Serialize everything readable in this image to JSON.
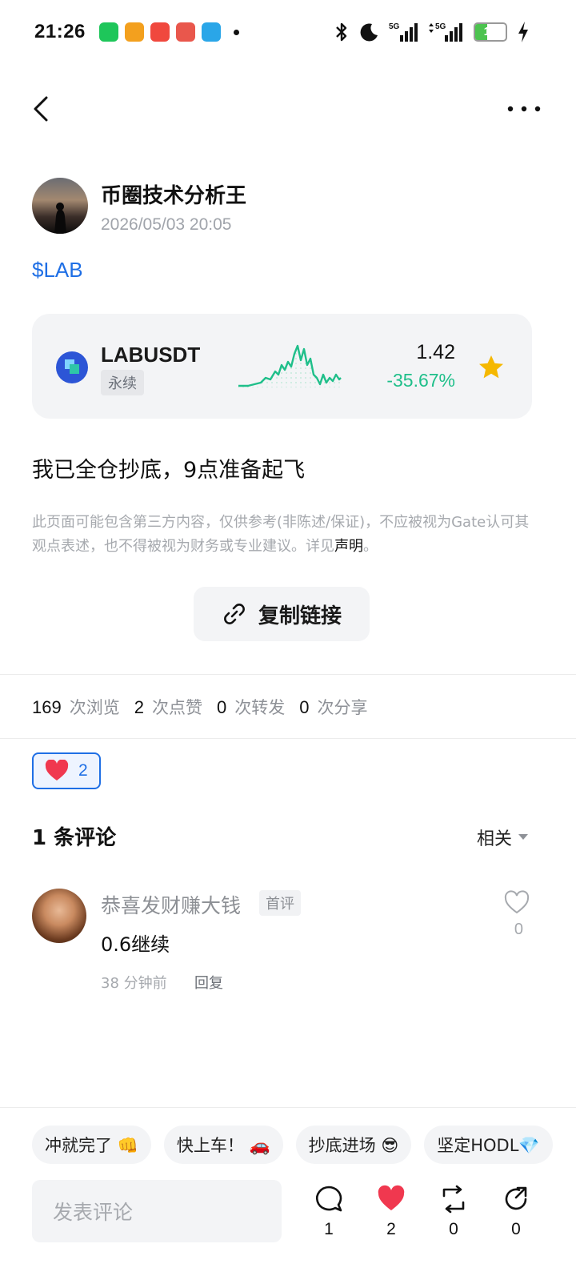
{
  "status_bar": {
    "time": "21:26",
    "battery": "15",
    "network_1": "5G",
    "network_2": "5G"
  },
  "post": {
    "author_name": "币圈技术分析王",
    "timestamp": "2026/05/03 20:05",
    "ticker_tag": "$LAB",
    "body": "我已全仓抄底，9点准备起飞",
    "disclaimer_text": "此页面可能包含第三方内容，仅供参考(非陈述/保证)，不应被视为Gate认可其观点表述，也不得被视为财务或专业建议。详见",
    "disclaimer_link": "声明",
    "disclaimer_end": "。",
    "copy_link_label": "复制链接"
  },
  "market_card": {
    "pair": "LABUSDT",
    "type": "永续",
    "price": "1.42",
    "change": "-35.67%",
    "favorited": true,
    "colors": {
      "up": "#1fbf8a",
      "star": "#f5b800"
    }
  },
  "stats": [
    {
      "count": "169",
      "label": "次浏览"
    },
    {
      "count": "2",
      "label": "次点赞"
    },
    {
      "count": "0",
      "label": "次转发"
    },
    {
      "count": "0",
      "label": "次分享"
    }
  ],
  "reaction": {
    "icon": "heart-icon",
    "count": "2"
  },
  "comments": {
    "header": "1 条评论",
    "sort_label": "相关",
    "items": [
      {
        "author": "恭喜发财赚大钱",
        "badge": "首评",
        "text": "0.6继续",
        "time": "38 分钟前",
        "reply_label": "回复",
        "likes": "0"
      }
    ]
  },
  "quick_replies": [
    "冲就完了 👊",
    "快上车！ 🚗",
    "抄底进场 😎",
    "坚定HODL💎"
  ],
  "bottom_bar": {
    "input_placeholder": "发表评论",
    "comment_count": "1",
    "like_count": "2",
    "repost_count": "0",
    "share_count": "0"
  },
  "accent_color": "#1f6fe5"
}
